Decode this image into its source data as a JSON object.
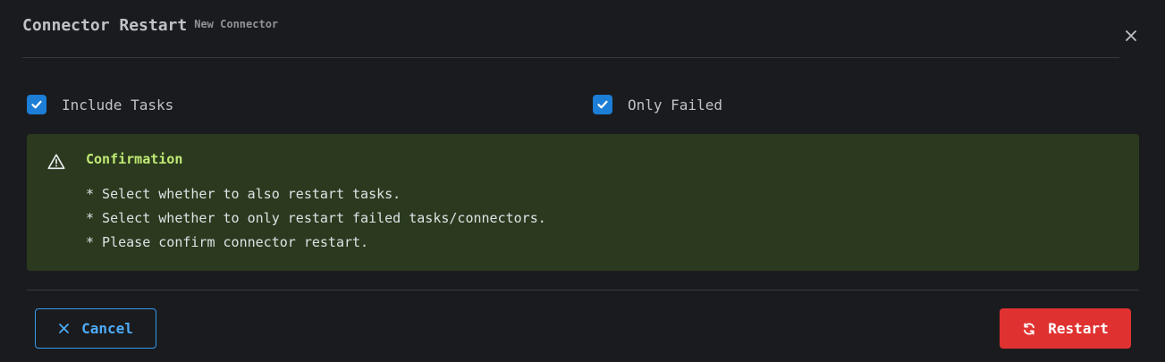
{
  "modal": {
    "title": "Connector Restart",
    "subtitle": "New Connector",
    "close_icon": "close-icon"
  },
  "options": {
    "include_tasks": {
      "label": "Include Tasks",
      "checked": true
    },
    "only_failed": {
      "label": "Only Failed",
      "checked": true
    }
  },
  "alert": {
    "icon": "warning-triangle-icon",
    "title": "Confirmation",
    "lines": [
      "* Select whether to also restart tasks.",
      "* Select whether to only restart failed tasks/connectors.",
      "* Please confirm connector restart."
    ],
    "background": "#2b3a1e",
    "title_color": "#c0eb75"
  },
  "footer": {
    "cancel_label": "Cancel",
    "cancel_icon": "x-icon",
    "restart_label": "Restart",
    "restart_icon": "refresh-icon"
  },
  "colors": {
    "checkbox_accent": "#1c7ed6",
    "cancel_accent": "#339af0",
    "restart_accent": "#e03131"
  }
}
